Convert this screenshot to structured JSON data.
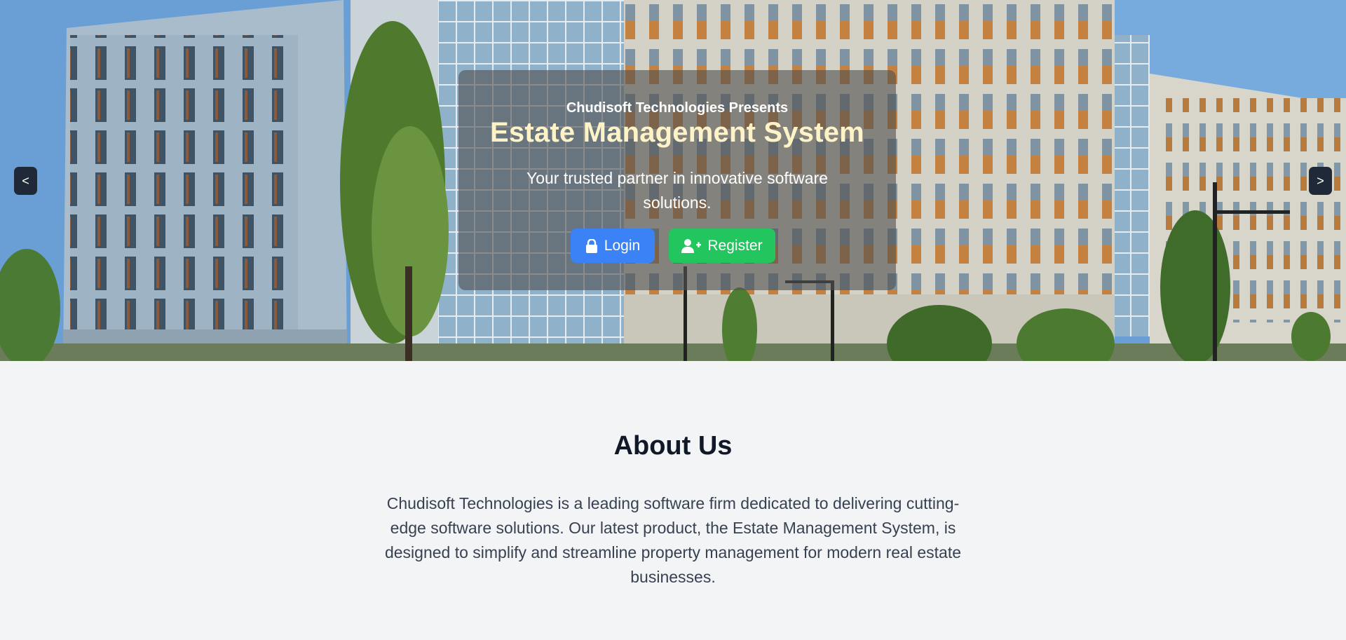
{
  "hero": {
    "presents": "Chudisoft Technologies Presents",
    "title": "Estate Management System",
    "tagline": "Your trusted partner in innovative software solutions.",
    "login_label": "Login",
    "register_label": "Register",
    "prev_label": "<",
    "next_label": ">",
    "login_icon": "lock-icon",
    "register_icon": "user-plus-icon",
    "colors": {
      "title": "#fef3c7",
      "login": "#3b82f6",
      "register": "#22c55e",
      "nav": "#1f2937"
    }
  },
  "about": {
    "title": "About Us",
    "text": "Chudisoft Technologies is a leading software firm dedicated to delivering cutting-edge software solutions. Our latest product, the Estate Management System, is designed to simplify and streamline property management for modern real estate businesses."
  }
}
